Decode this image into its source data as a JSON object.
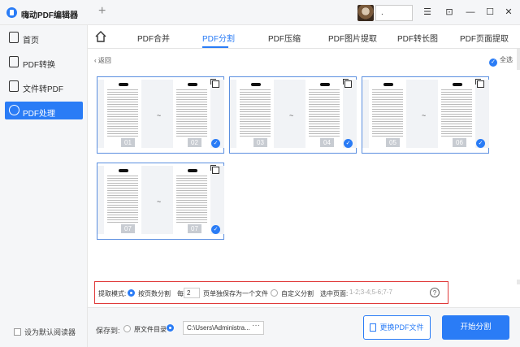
{
  "app": {
    "title": "嗨动PDF编辑器",
    "new_tab": "+",
    "user_name": "."
  },
  "window_controls": {
    "menu": "☰",
    "pin": "⊡",
    "minimize": "—",
    "maximize": "☐",
    "close": "✕"
  },
  "sidebar": {
    "items": [
      {
        "label": "首页",
        "icon": "home-icon"
      },
      {
        "label": "PDF转换",
        "icon": "convert-icon"
      },
      {
        "label": "文件转PDF",
        "icon": "file-to-pdf-icon"
      },
      {
        "label": "PDF处理",
        "icon": "pdf-process-icon",
        "active": true
      }
    ],
    "default_reader": "设为默认阅读器"
  },
  "tabs": [
    {
      "label": "PDF合并"
    },
    {
      "label": "PDF分割",
      "active": true
    },
    {
      "label": "PDF压缩"
    },
    {
      "label": "PDF图片提取"
    },
    {
      "label": "PDF转长图"
    },
    {
      "label": "PDF页面提取"
    }
  ],
  "toolbar": {
    "back": "返回",
    "select_all": "全选"
  },
  "cards": [
    {
      "left": "01",
      "right": "02",
      "sep": "~"
    },
    {
      "left": "03",
      "right": "04",
      "sep": "~"
    },
    {
      "left": "05",
      "right": "06",
      "sep": "~"
    },
    {
      "left": "07",
      "right": "07",
      "sep": "~"
    }
  ],
  "options": {
    "mode_label": "提取模式:",
    "by_pages": "按页数分割",
    "every": "每",
    "pages_value": "2",
    "pages_suffix": "页单独保存为一个文件",
    "custom": "自定义分割",
    "selected_pages_label": "选中页面:",
    "range_placeholder": "1-2;3-4;5-6;7-7",
    "help": "?"
  },
  "bottom": {
    "save_to": "保存到:",
    "original_dir": "原文件目录",
    "path": "C:\\Users\\Administra...",
    "browse": "···",
    "change_file": "更换PDF文件",
    "start": "开始分割"
  },
  "colors": {
    "accent": "#2a7cf6",
    "highlight_border": "#e03a3a"
  }
}
